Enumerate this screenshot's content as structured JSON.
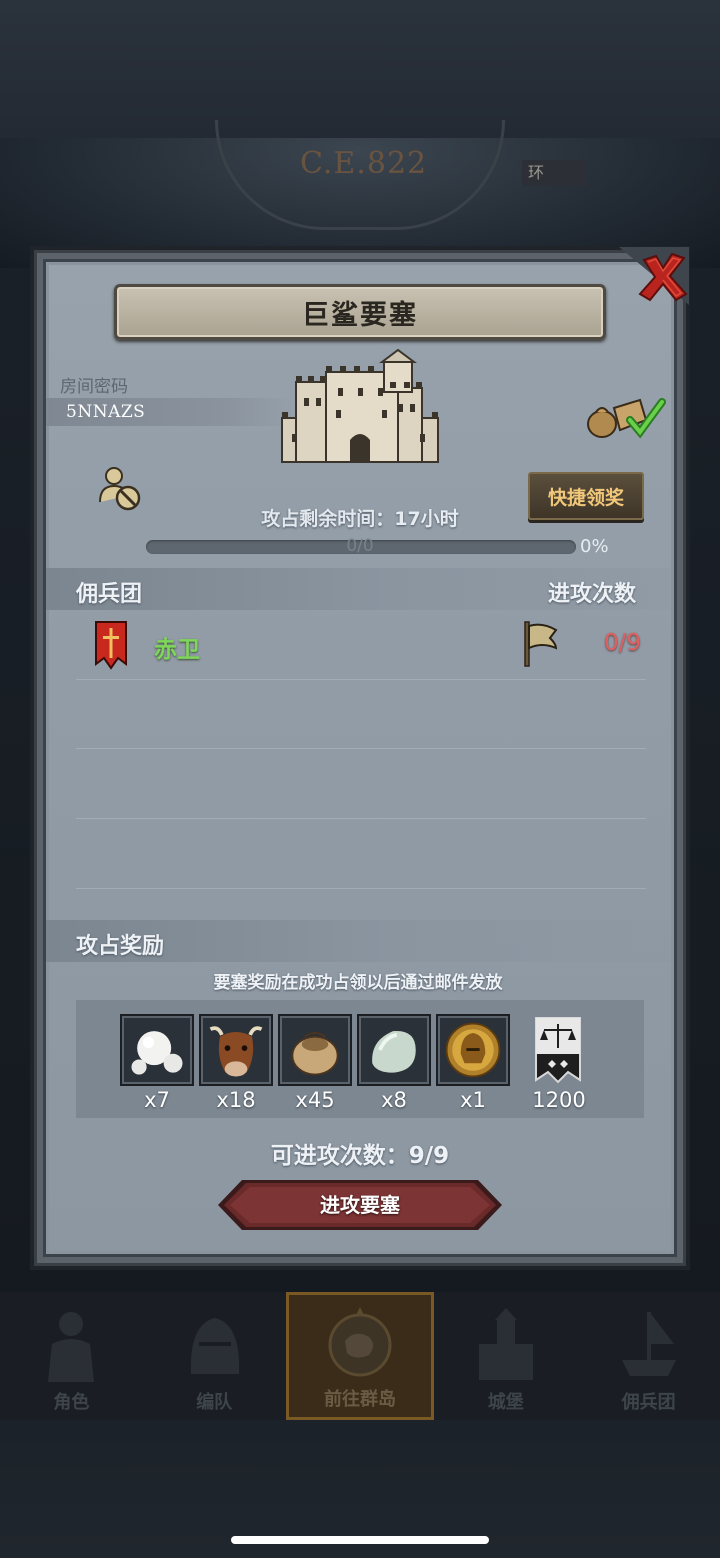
{
  "background": {
    "year": "C.E.822",
    "header_tag": "环"
  },
  "modal": {
    "title": "巨鲨要塞",
    "room_label": "房间密码",
    "room_code": "5NNAZS",
    "quick_claim_label": "快捷领奖",
    "time_left_label": "攻占剩余时间：",
    "time_left_value": "17小时",
    "progress": {
      "text": "0/0",
      "percent_text": "0%",
      "fraction": 0
    },
    "mercenary_section": {
      "title": "佣兵团",
      "attack_count_header": "进攻次数",
      "rows": [
        {
          "name": "赤卫",
          "attack_count": "0/9"
        }
      ]
    },
    "reward_section": {
      "title": "攻占奖励",
      "note": "要塞奖励在成功占领以后通过邮件发放",
      "items": [
        {
          "icon": "pearl-icon",
          "qty": "x7"
        },
        {
          "icon": "cow-icon",
          "qty": "x18"
        },
        {
          "icon": "grain-sack-icon",
          "qty": "x45"
        },
        {
          "icon": "stone-icon",
          "qty": "x8"
        },
        {
          "icon": "gold-helmet-icon",
          "qty": "x1"
        },
        {
          "icon": "justice-banner-icon",
          "qty": "1200"
        }
      ]
    },
    "remaining_attacks_label": "可进攻次数：",
    "remaining_attacks_value": "9/9",
    "attack_button_label": "进攻要塞"
  },
  "bottom_nav": [
    {
      "label": "角色",
      "icon": "knight-icon",
      "active": false
    },
    {
      "label": "编队",
      "icon": "helmet-icon",
      "active": false
    },
    {
      "label": "前往群岛",
      "icon": "compass-map-icon",
      "active": true
    },
    {
      "label": "城堡",
      "icon": "castle-icon",
      "active": false
    },
    {
      "label": "佣兵团",
      "icon": "ship-icon",
      "active": false
    }
  ],
  "colors": {
    "merc_name": "#7ed65a",
    "attack_count": "#e06060",
    "quick_claim_text": "#f1c87a",
    "attack_button": "#6b2a2a"
  }
}
